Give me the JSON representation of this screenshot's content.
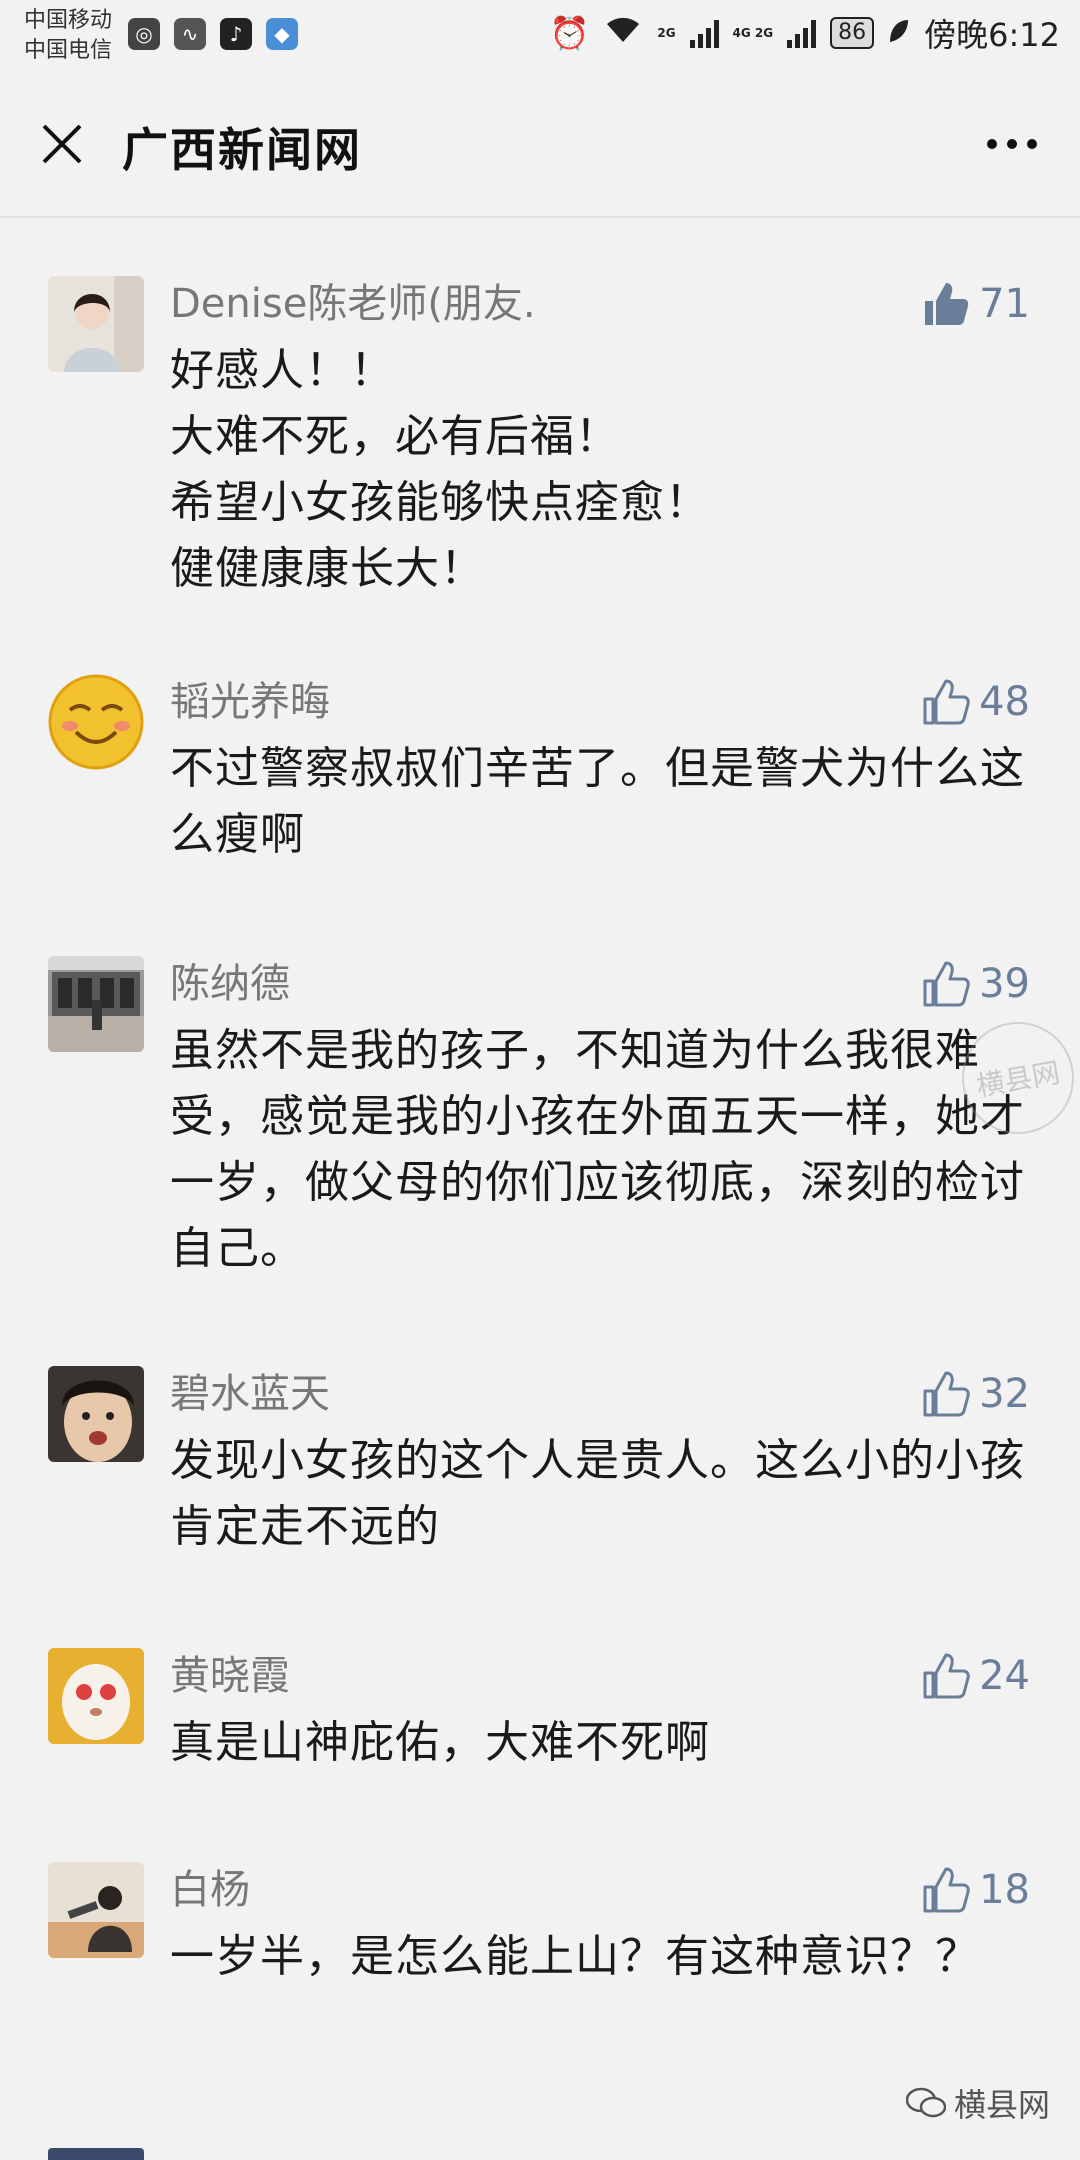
{
  "status_bar": {
    "carrier_1": "中国移动",
    "carrier_2": "中国电信",
    "battery": "86",
    "time": "傍晚6:12",
    "net_1": "2G",
    "net_2": "4G 2G"
  },
  "header": {
    "title": "广西新闻网"
  },
  "comments": [
    {
      "name": "Denise陈老师(朋友.",
      "likes": "71",
      "liked": true,
      "text": "好感人！！\n大难不死，必有后福！\n希望小女孩能够快点痊愈！\n健健康康长大！"
    },
    {
      "name": "韬光养晦",
      "likes": "48",
      "liked": false,
      "text": "不过警察叔叔们辛苦了。但是警犬为什么这么瘦啊"
    },
    {
      "name": "陈纳德",
      "likes": "39",
      "liked": false,
      "text": "虽然不是我的孩子，不知道为什么我很难受，感觉是我的小孩在外面五天一样，她才一岁，做父母的你们应该彻底，深刻的检讨自己。"
    },
    {
      "name": "碧水蓝天",
      "likes": "32",
      "liked": false,
      "text": "发现小女孩的这个人是贵人。这么小的小孩肯定走不远的"
    },
    {
      "name": "黄晓霞",
      "likes": "24",
      "liked": false,
      "text": "真是山神庇佑，大难不死啊"
    },
    {
      "name": "白杨",
      "likes": "18",
      "liked": false,
      "text": "一岁半，是怎么能上山？有这种意识？？"
    }
  ],
  "watermark": {
    "round": "横县网",
    "bottom": "横县网"
  },
  "colors": {
    "background": "#f2f2f2",
    "like_blue": "#6a7d99",
    "name_gray": "#777777"
  }
}
